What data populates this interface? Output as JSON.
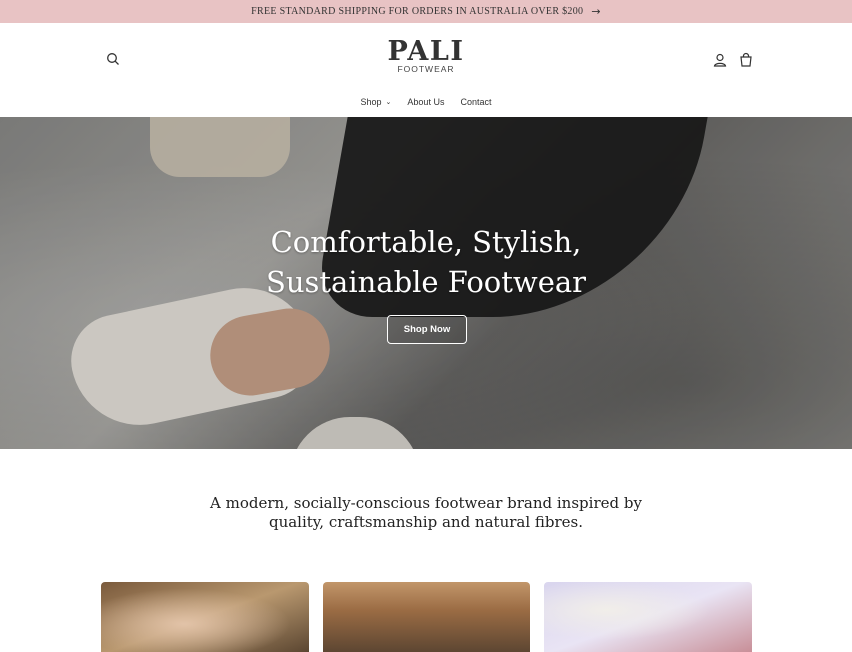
{
  "announcement": {
    "text": "FREE STANDARD SHIPPING FOR ORDERS IN AUSTRALIA OVER $200",
    "arrow": "→"
  },
  "header": {
    "brand": "PALI",
    "brand_sub": "FOOTWEAR"
  },
  "nav": {
    "items": [
      {
        "label": "Shop",
        "has_dropdown": true,
        "chevron": "⌄"
      },
      {
        "label": "About Us"
      },
      {
        "label": "Contact"
      }
    ]
  },
  "hero": {
    "title_line1": "Comfortable, Stylish,",
    "title_line2": "Sustainable Footwear",
    "button": "Shop Now"
  },
  "tagline": {
    "line1": "A modern, socially-conscious footwear brand inspired by",
    "line2": "quality, craftsmanship and natural fibres."
  },
  "colors": {
    "announcement_bg": "#e8c3c4",
    "text": "#222222"
  },
  "icons": {
    "search": "search-icon",
    "account": "user-icon",
    "cart": "cart-icon"
  }
}
